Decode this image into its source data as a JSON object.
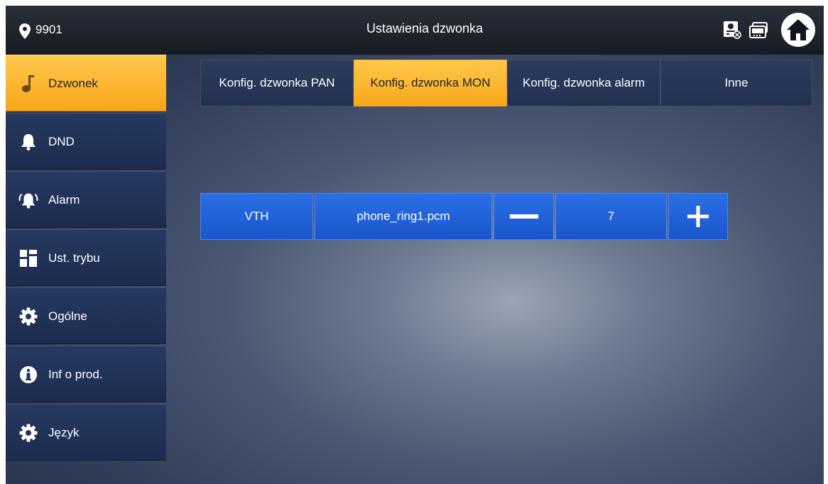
{
  "header": {
    "room_number": "9901",
    "title": "Ustawienia dzwonka",
    "icons": [
      "location-pin-icon",
      "vto-status-icon",
      "monitor-icon",
      "home-icon"
    ]
  },
  "sidebar": {
    "items": [
      {
        "label": "Dzwonek",
        "icon": "music-note-icon",
        "active": true
      },
      {
        "label": "DND",
        "icon": "bell-icon"
      },
      {
        "label": "Alarm",
        "icon": "alarm-icon"
      },
      {
        "label": "Ust. trybu",
        "icon": "mode-grid-icon"
      },
      {
        "label": "Ogólne",
        "icon": "gear-icon"
      },
      {
        "label": "Inf o prod.",
        "icon": "info-icon"
      },
      {
        "label": "Język",
        "icon": "gear-icon"
      }
    ]
  },
  "tabs": [
    {
      "label": "Konfig. dzwonka PAN"
    },
    {
      "label": "Konfig. dzwonka MON",
      "active": true
    },
    {
      "label": "Konfig. dzwonka alarm"
    },
    {
      "label": "Inne"
    }
  ],
  "ring_setting": {
    "device": "VTH",
    "ringtone": "phone_ring1.pcm",
    "volume": "7"
  },
  "colors": {
    "accent": "#f8a51a",
    "cell_blue": "#1f5fd8",
    "sidebar_blue": "#233459"
  }
}
